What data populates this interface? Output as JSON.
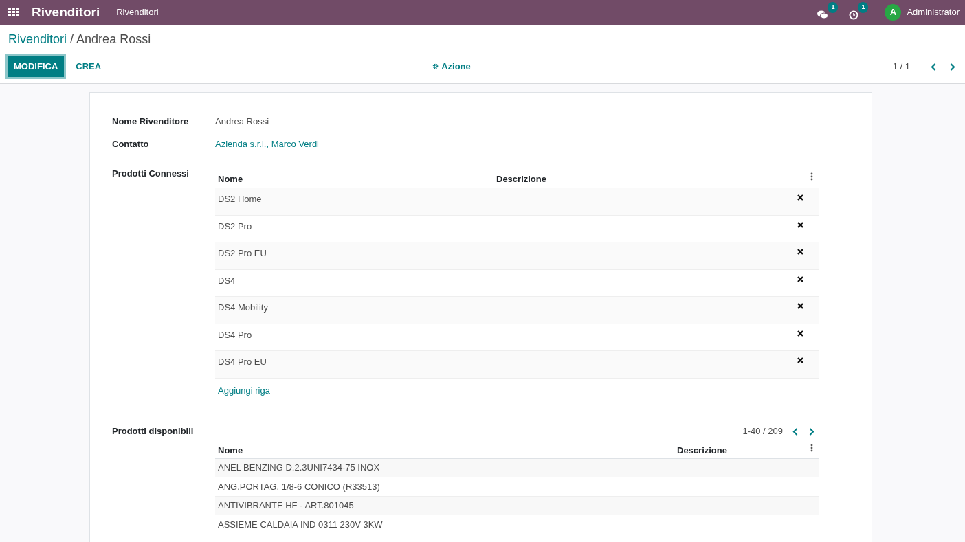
{
  "navbar": {
    "app_title": "Rivenditori",
    "menu": [
      "Rivenditori"
    ],
    "messages_count": "1",
    "activities_count": "1",
    "user": {
      "initial": "A",
      "name": "Administrator"
    }
  },
  "breadcrumb": {
    "parent": "Rivenditori",
    "separator": "/",
    "current": "Andrea Rossi"
  },
  "buttons": {
    "primary": "MODIFICA",
    "secondary": "CREA",
    "action": "Azione"
  },
  "pager": "1 / 1",
  "fields": [
    {
      "label": "Nome Rivenditore",
      "value": "Andrea Rossi",
      "kind": "text"
    },
    {
      "label": "Contatto",
      "value": "Azienda s.r.l., Marco Verdi",
      "kind": "link"
    }
  ],
  "connected": {
    "label": "Prodotti Connessi",
    "columns": [
      "Nome",
      "Descrizione"
    ],
    "rows": [
      {
        "name": "DS2 Home"
      },
      {
        "name": "DS2 Pro"
      },
      {
        "name": "DS2 Pro EU"
      },
      {
        "name": "DS4"
      },
      {
        "name": "DS4 Mobility"
      },
      {
        "name": "DS4 Pro"
      },
      {
        "name": "DS4 Pro EU"
      }
    ],
    "add_line": "Aggiungi riga"
  },
  "available": {
    "label": "Prodotti disponibili",
    "pager": "1-40 / 209",
    "columns": [
      "Nome",
      "Descrizione"
    ],
    "rows": [
      {
        "name": "ANEL BENZING D.2.3UNI7434-75 INOX"
      },
      {
        "name": "ANG.PORTAG. 1/8-6 CONICO (R33513)"
      },
      {
        "name": "ANTIVIBRANTE HF - ART.801045"
      },
      {
        "name": "ASSIEME CALDAIA IND 0311 230V 3KW"
      }
    ]
  }
}
